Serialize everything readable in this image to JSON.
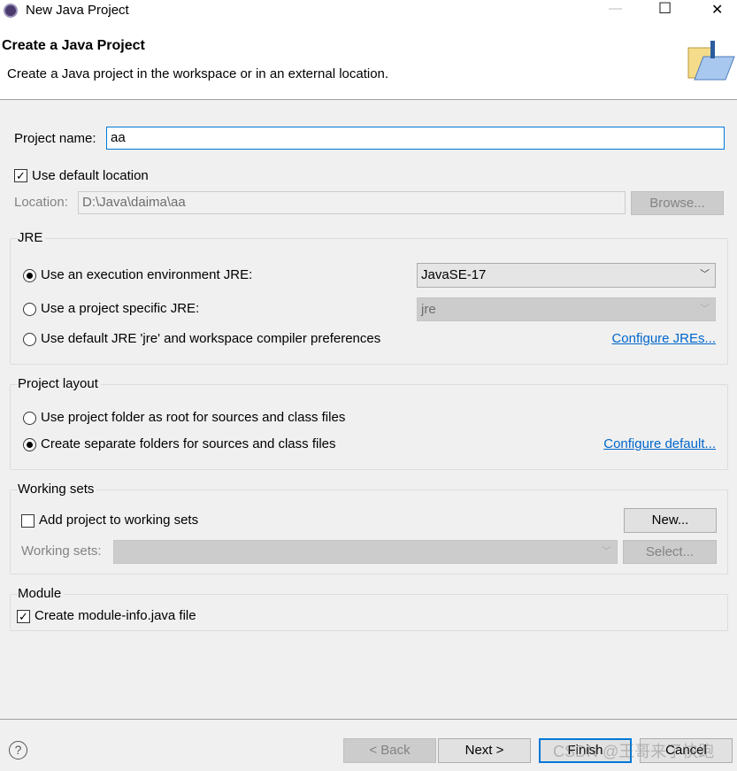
{
  "window": {
    "title": "New Java Project",
    "minimize": "—",
    "maximize": "☐",
    "close": "✕"
  },
  "header": {
    "title": "Create a Java Project",
    "description": "Create a Java project in the workspace or in an external location."
  },
  "project_name": {
    "label": "Project name:",
    "value": "aa"
  },
  "use_default_location": {
    "label": "Use default location",
    "checked": true
  },
  "location": {
    "label": "Location:",
    "value": "D:\\Java\\daima\\aa",
    "browse": "Browse..."
  },
  "jre": {
    "title": "JRE",
    "option1": "Use an execution environment JRE:",
    "option1_value": "JavaSE-17",
    "option2": "Use a project specific JRE:",
    "option2_value": "jre",
    "option3": "Use default JRE 'jre' and workspace compiler preferences",
    "configure": "Configure JREs..."
  },
  "layout": {
    "title": "Project layout",
    "option1": "Use project folder as root for sources and class files",
    "option2": "Create separate folders for sources and class files",
    "configure": "Configure default..."
  },
  "working_sets": {
    "title": "Working sets",
    "add": "Add project to working sets",
    "new": "New...",
    "label": "Working sets:",
    "value": "",
    "select": "Select..."
  },
  "module": {
    "title": "Module",
    "create": "Create module-info.java file",
    "checked": true
  },
  "footer": {
    "help": "?",
    "back": "< Back",
    "next": "Next >",
    "finish": "Finish",
    "cancel": "Cancel",
    "watermark": "CSDN @王哥来了快跑"
  }
}
